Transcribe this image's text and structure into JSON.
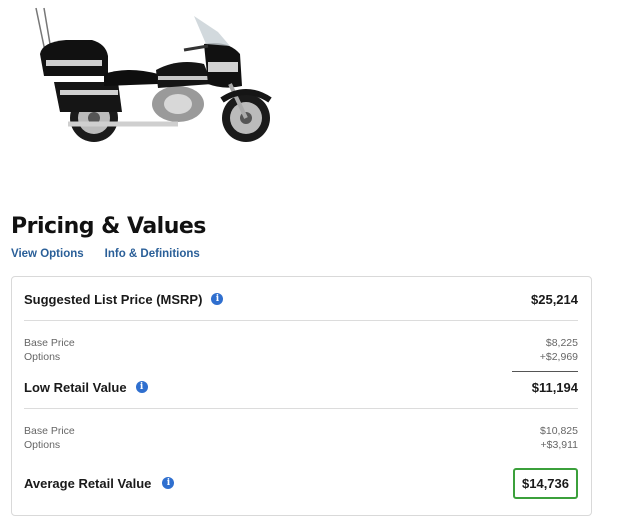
{
  "product": {
    "image_icon": "motorcycle-image"
  },
  "header": {
    "title": "Pricing & Values",
    "links": [
      "View Options",
      "Info & Definitions"
    ]
  },
  "pricing": {
    "msrp": {
      "label": "Suggested List Price (MSRP)",
      "value": "$25,214"
    },
    "low_retail": {
      "base_label": "Base Price",
      "base_value": "$8,225",
      "options_label": "Options",
      "options_value": "+$2,969",
      "label": "Low Retail Value",
      "value": "$11,194"
    },
    "average_retail": {
      "base_label": "Base Price",
      "base_value": "$10,825",
      "options_label": "Options",
      "options_value": "+$3,911",
      "label": "Average Retail Value",
      "value": "$14,736"
    }
  },
  "colors": {
    "link": "#2a5f98",
    "info_icon": "#2f6fcf",
    "highlight_border": "#3ba03b"
  }
}
